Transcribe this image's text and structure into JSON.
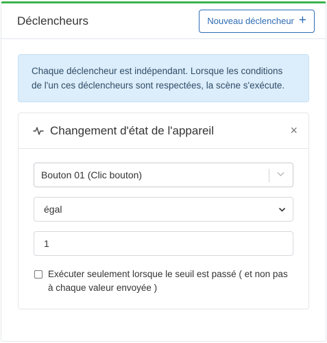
{
  "header": {
    "title": "Déclencheurs",
    "new_button_label": "Nouveau déclencheur",
    "new_button_icon": "+"
  },
  "info": {
    "text": "Chaque déclencheur est indépendant. Lorsque les conditions de l'un ces déclencheurs sont respectées, la scène s'exécute."
  },
  "trigger": {
    "icon": "pulse-icon",
    "title": "Changement d'état de l'appareil",
    "close_icon": "×",
    "device_value": "Bouton 01 (Clic bouton)",
    "operator_value": "égal",
    "value": "1",
    "checkbox_label": "Exécuter seulement lorsque le seuil est passé ( et non pas à chaque valeur envoyée )",
    "checkbox_checked": false
  },
  "colors": {
    "accent_green": "#3cb34a",
    "primary_blue": "#2c6bb3",
    "info_bg": "#dcedfb"
  }
}
